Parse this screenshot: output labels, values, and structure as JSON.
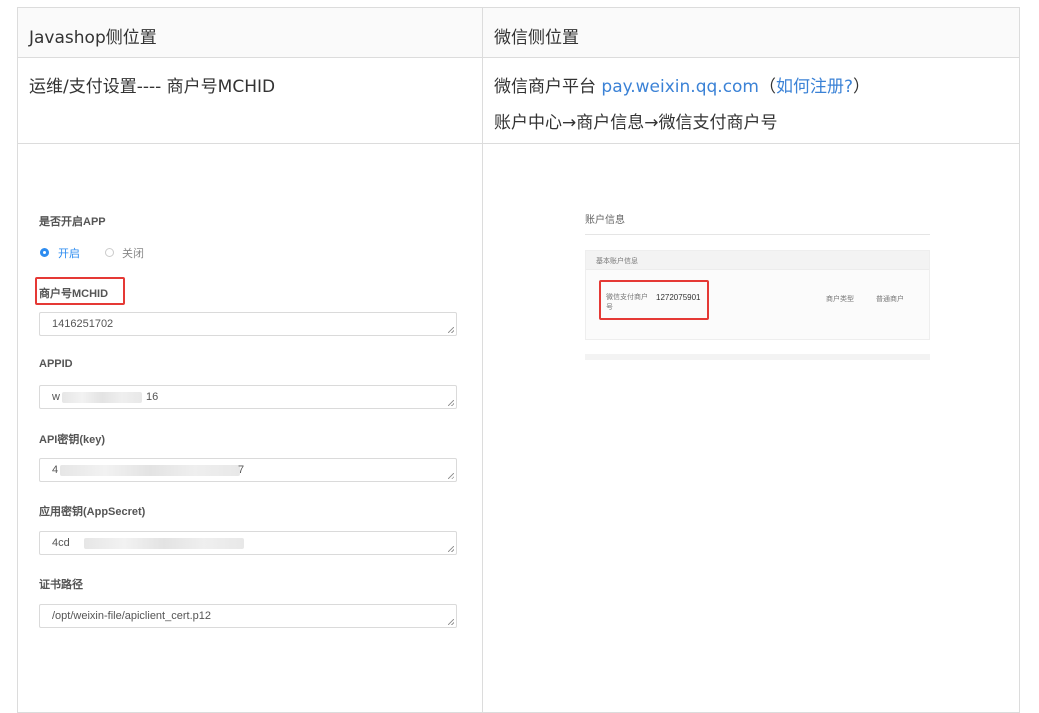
{
  "table": {
    "headers": [
      "Javashop侧位置",
      "微信侧位置"
    ],
    "row1": {
      "left": "运维/支付设置---- 商户号MCHID",
      "right_prefix": "微信商户平台 ",
      "right_link": "pay.weixin.qq.com",
      "right_paren_open": "（",
      "right_register_link": "如何注册?",
      "right_paren_close": "）",
      "right_line2": "账户中心→商户信息→微信支付商户号"
    }
  },
  "javashop_form": {
    "enable_app_label": "是否开启APP",
    "radio_on": "开启",
    "radio_off": "关闭",
    "mchid_label": "商户号MCHID",
    "mchid_value": "1416251702",
    "appid_label": "APPID",
    "appid_value_start": "w",
    "appid_value_end": "16",
    "apikey_label": "API密钥(key)",
    "apikey_value_start": "4",
    "apikey_value_end": "7",
    "appsecret_label": "应用密钥(AppSecret)",
    "appsecret_value_start": "4cd",
    "cert_label": "证书路径",
    "cert_value": "/opt/weixin-file/apiclient_cert.p12"
  },
  "wechat_panel": {
    "title": "账户信息",
    "section": "基本账户信息",
    "merchant_no_label": "微信支付商户号",
    "merchant_no_value": "1272075901",
    "merchant_type_label": "商户类型",
    "merchant_type_value": "普通商户"
  },
  "colors": {
    "accent": "#3b82d6",
    "highlight": "#e53935",
    "radio": "#2d8cf0"
  }
}
